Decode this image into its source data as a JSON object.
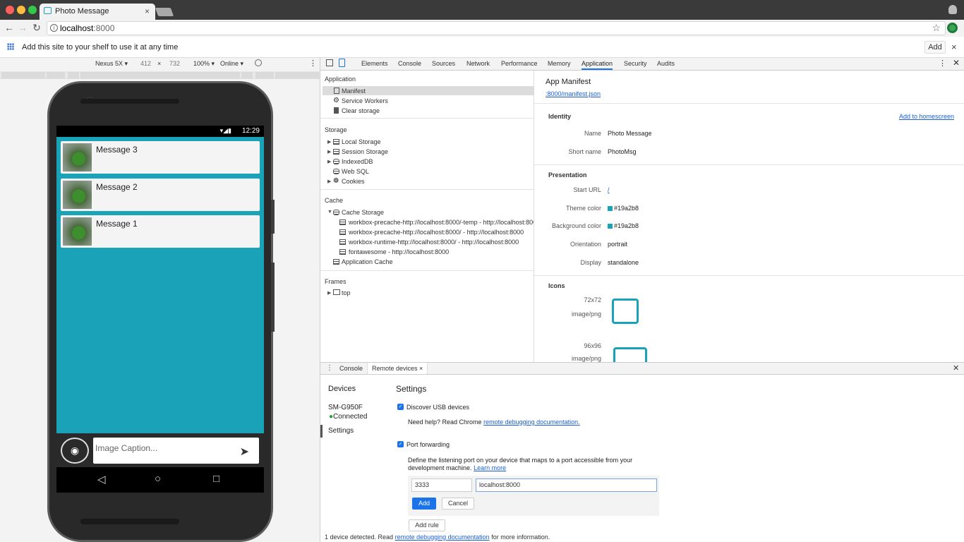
{
  "browser": {
    "tab_title": "Photo Message",
    "tab_close": "×",
    "url_host": "localhost",
    "url_port": ":8000",
    "shelf_text": "Add this site to your shelf to use it at any time",
    "shelf_add": "Add",
    "shelf_close": "×"
  },
  "device_toolbar": {
    "device": "Nexus 5X ▾",
    "width": "412",
    "times": "×",
    "height": "732",
    "zoom": "100% ▾",
    "network": "Online ▾"
  },
  "phone": {
    "status_time": "12:29",
    "messages": [
      {
        "title": "Message 3"
      },
      {
        "title": "Message 2"
      },
      {
        "title": "Message 1"
      }
    ],
    "caption_placeholder": "Image Caption..."
  },
  "devtools": {
    "tabs": [
      "Elements",
      "Console",
      "Sources",
      "Network",
      "Performance",
      "Memory",
      "Application",
      "Security",
      "Audits"
    ],
    "sidebar": {
      "application_title": "Application",
      "application_items": [
        "Manifest",
        "Service Workers",
        "Clear storage"
      ],
      "storage_title": "Storage",
      "storage_items": [
        "Local Storage",
        "Session Storage",
        "IndexedDB",
        "Web SQL",
        "Cookies"
      ],
      "cache_title": "Cache",
      "cache_storage": "Cache Storage",
      "cache_entries": [
        "workbox-precache-http://localhost:8000/-temp - http://localhost:800",
        "workbox-precache-http://localhost:8000/ - http://localhost:8000",
        "workbox-runtime-http://localhost:8000/ - http://localhost:8000",
        "fontawesome - http://localhost:8000"
      ],
      "application_cache": "Application Cache",
      "frames_title": "Frames",
      "frames_top": "top"
    },
    "manifest": {
      "title": "App Manifest",
      "url": ":8000/manifest.json",
      "identity_title": "Identity",
      "add_to_homescreen": "Add to homescreen",
      "name_label": "Name",
      "name_value": "Photo Message",
      "short_name_label": "Short name",
      "short_name_value": "PhotoMsg",
      "presentation_title": "Presentation",
      "start_url_label": "Start URL",
      "start_url_value": "/",
      "theme_color_label": "Theme color",
      "theme_color_value": "#19a2b8",
      "bg_color_label": "Background color",
      "bg_color_value": "#19a2b8",
      "orientation_label": "Orientation",
      "orientation_value": "portrait",
      "display_label": "Display",
      "display_value": "standalone",
      "icons_title": "Icons",
      "icon1_size": "72x72",
      "icon1_type": "image/png",
      "icon2_size": "96x96",
      "icon2_type": "image/png"
    },
    "drawer": {
      "console_tab": "Console",
      "remote_tab": "Remote devices",
      "remote_close": "×",
      "devices_title": "Devices",
      "device_name": "SM-G950F",
      "device_status": "Connected",
      "settings_item": "Settings",
      "settings_title": "Settings",
      "discover_usb": "Discover USB devices",
      "need_help": "Need help? Read Chrome ",
      "remote_debug_link": "remote debugging documentation.",
      "port_forwarding": "Port forwarding",
      "pf_desc_1": "Define the listening port on your device that maps to a port accessible from your",
      "pf_desc_2": "development machine. ",
      "learn_more": "Learn more",
      "port_value": "3333",
      "address_value": "localhost:8000",
      "add_button": "Add",
      "cancel_button": "Cancel",
      "add_rule_button": "Add rule",
      "footer_1": "1 device detected. Read ",
      "footer_link": "remote debugging documentation",
      "footer_2": " for more information."
    }
  },
  "colors": {
    "theme": "#19a2b8",
    "link": "#1a5fd8",
    "accent": "#1a73e8"
  }
}
